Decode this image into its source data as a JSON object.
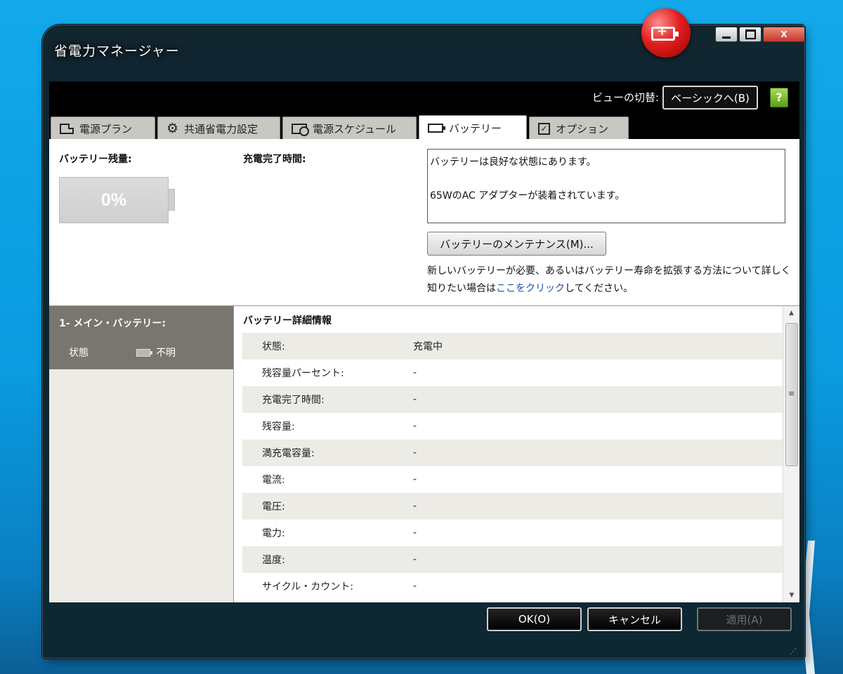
{
  "window": {
    "title": "省電力マネージャー",
    "close_label": "X"
  },
  "topbar": {
    "view_switch_label": "ビューの切替:",
    "basic_button": "ベーシックへ(B)",
    "help_icon_glyph": "?"
  },
  "tabs": [
    {
      "label": "電源プラン",
      "icon": "power-plan-icon"
    },
    {
      "label": "共通省電力設定",
      "icon": "gear-icon"
    },
    {
      "label": "電源スケジュール",
      "icon": "schedule-icon"
    },
    {
      "label": "バッテリー",
      "icon": "battery-icon",
      "active": true
    },
    {
      "label": "オプション",
      "icon": "checkbox-icon"
    }
  ],
  "battery_summary": {
    "remaining_label": "バッテリー残量:",
    "remaining_value": "0%",
    "charge_time_label": "充電完了時間:",
    "status_lines": [
      "バッテリーは良好な状態にあります。",
      "65WのAC アダプターが装着されています。"
    ],
    "maintenance_button": "バッテリーのメンテナンス(M)...",
    "note_before": "新しいバッテリーが必要、あるいはバッテリー寿命を拡張する方法について詳しく知りたい場合は",
    "note_link": "ここをクリック",
    "note_after": "してください。"
  },
  "battery_list": {
    "name": "1- メイン・バッテリー:",
    "state_label": "状態",
    "state_value": "不明"
  },
  "details": {
    "title": "バッテリー詳細情報",
    "rows": [
      {
        "key": "状態:",
        "value": "充電中"
      },
      {
        "key": "残容量パーセント:",
        "value": "-"
      },
      {
        "key": "充電完了時間:",
        "value": "-"
      },
      {
        "key": "残容量:",
        "value": "-"
      },
      {
        "key": "満充電容量:",
        "value": "-"
      },
      {
        "key": "電流:",
        "value": "-"
      },
      {
        "key": "電圧:",
        "value": "-"
      },
      {
        "key": "電力:",
        "value": "-"
      },
      {
        "key": "温度:",
        "value": "-"
      },
      {
        "key": "サイクル・カウント:",
        "value": "-"
      }
    ]
  },
  "footer": {
    "ok": "OK(O)",
    "cancel": "キャンセル",
    "apply": "適用(A)"
  }
}
